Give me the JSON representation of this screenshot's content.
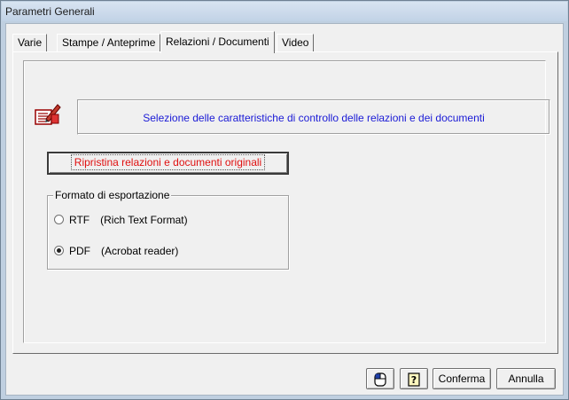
{
  "window": {
    "title": "Parametri Generali"
  },
  "tabs": [
    {
      "label": "Varie"
    },
    {
      "label": "Stampe / Anteprime"
    },
    {
      "label": "Relazioni / Documenti"
    },
    {
      "label": "Video"
    }
  ],
  "active_tab": "Relazioni / Documenti",
  "header": {
    "text": "Selezione delle caratteristiche di controllo delle relazioni e dei documenti",
    "icon": "document-edit-icon"
  },
  "restore_button": {
    "label": "Ripristina relazioni e documenti originali"
  },
  "export_group": {
    "legend": "Formato di esportazione",
    "options": [
      {
        "name": "RTF",
        "desc": "(Rich Text Format)",
        "checked": false
      },
      {
        "name": "PDF",
        "desc": "(Acrobat reader)",
        "checked": true
      }
    ]
  },
  "footer": {
    "icon_buttons": [
      "mouse-icon",
      "help-icon"
    ],
    "confirm_label": "Conferma",
    "cancel_label": "Annulla"
  },
  "colors": {
    "header_text": "#1a1ad6",
    "restore_text": "#e01010",
    "window_frame": "#bfcfe0"
  }
}
